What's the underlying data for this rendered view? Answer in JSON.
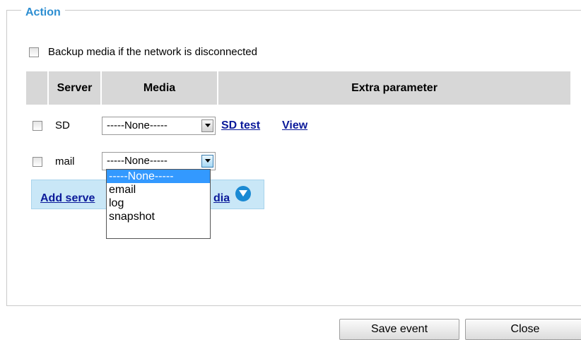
{
  "section": {
    "legend": "Action"
  },
  "backup": {
    "label": "Backup media if the network is disconnected",
    "checked": false
  },
  "table": {
    "headers": {
      "server": "Server",
      "media": "Media",
      "extra": "Extra parameter"
    },
    "rows": [
      {
        "server": "SD",
        "media_value": "-----None-----",
        "links": [
          "SD test",
          "View"
        ]
      },
      {
        "server": "mail",
        "media_value": "-----None-----"
      }
    ]
  },
  "add_bar": {
    "label_left": "Add serve",
    "label_right": "dia",
    "icon": "chevron-down-circle-icon"
  },
  "dropdown": {
    "options": [
      "-----None-----",
      "email",
      "log",
      "snapshot"
    ],
    "highlighted": "-----None-----"
  },
  "buttons": {
    "save": "Save event",
    "close": "Close"
  },
  "colors": {
    "accent": "#2d8ed1",
    "link": "#0b1a9a",
    "header_bg": "#d7d7d7",
    "add_bar_bg": "#c9e7f7",
    "highlight": "#3399ff"
  }
}
